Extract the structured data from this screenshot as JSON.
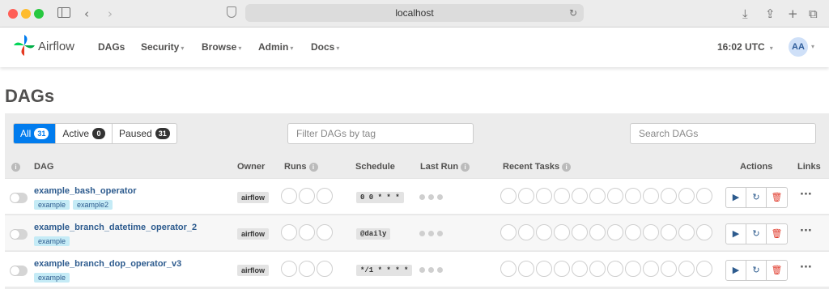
{
  "browser": {
    "url": "localhost"
  },
  "navbar": {
    "brand": "Airflow",
    "items": [
      {
        "label": "DAGs",
        "caret": ""
      },
      {
        "label": "Security",
        "caret": "▾"
      },
      {
        "label": "Browse",
        "caret": "▾"
      },
      {
        "label": "Admin",
        "caret": "▾"
      },
      {
        "label": "Docs",
        "caret": "▾"
      }
    ],
    "time": "16:02 UTC",
    "time_caret": "▾",
    "avatar": "AA"
  },
  "page": {
    "title": "DAGs"
  },
  "filters": {
    "all": {
      "label": "All",
      "count": "31"
    },
    "active": {
      "label": "Active",
      "count": "0"
    },
    "paused": {
      "label": "Paused",
      "count": "31"
    },
    "tag_placeholder": "Filter DAGs by tag",
    "search_placeholder": "Search DAGs"
  },
  "table": {
    "headers": {
      "dag": "DAG",
      "owner": "Owner",
      "runs": "Runs",
      "schedule": "Schedule",
      "last_run": "Last Run",
      "recent_tasks": "Recent Tasks",
      "actions": "Actions",
      "links": "Links"
    },
    "rows": [
      {
        "name": "example_bash_operator",
        "tags": [
          "example",
          "example2"
        ],
        "owner": "airflow",
        "schedule": "0 0 * * *"
      },
      {
        "name": "example_branch_datetime_operator_2",
        "tags": [
          "example"
        ],
        "owner": "airflow",
        "schedule": "@daily"
      },
      {
        "name": "example_branch_dop_operator_v3",
        "tags": [
          "example"
        ],
        "owner": "airflow",
        "schedule": "*/1 * * * *"
      }
    ]
  },
  "icons": {
    "info": "i",
    "trigger": "▶",
    "refresh": "↻",
    "delete": "🗑",
    "links": "···"
  }
}
